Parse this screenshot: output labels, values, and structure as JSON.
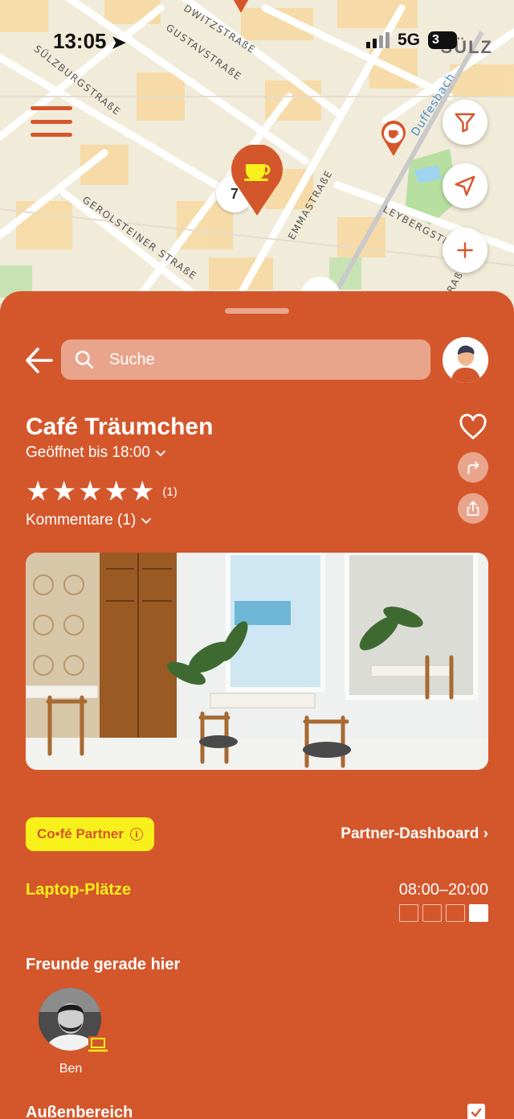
{
  "status_bar": {
    "time": "13:05",
    "network": "5G",
    "battery": "3"
  },
  "map": {
    "district": "SÜLZ",
    "streets": {
      "s1": "DWITZSTRAßE",
      "s2": "GUSTAVSTRAßE",
      "s3": "SÜLZBURGSTRAßE",
      "s4": "GEROLSTEINER STRAßE",
      "s5": "EMMASTRAßE",
      "s6": "LEYBERGSTR",
      "s7": "RAßE"
    },
    "water": "Duffesbach",
    "cluster_count": "7",
    "colors": {
      "accent": "#d4572c"
    }
  },
  "sheet": {
    "search_placeholder": "Suche",
    "cafe_name": "Café Träumchen",
    "opening": "Geöffnet bis 18:00",
    "stars": [
      "★",
      "★",
      "★",
      "★",
      "★"
    ],
    "rating_value": 5,
    "rating_count": "(1)",
    "comments": "Kommentare (1)",
    "partner_badge": "Co•fé Partner",
    "partner_info": "i",
    "dashboard_link": "Partner-Dashboard ›",
    "laptop_label": "Laptop-Plätze",
    "laptop_hours": "08:00–20:00",
    "laptop_occupancy": {
      "filled": 1,
      "total": 4
    },
    "friends_label": "Freunde gerade hier",
    "friends": [
      {
        "name": "Ben",
        "laptop": true
      }
    ],
    "outdoor_label": "Außenbereich",
    "outdoor_checked": true,
    "colors": {
      "sheet": "#d4572c",
      "highlight": "#f7f01a"
    }
  }
}
